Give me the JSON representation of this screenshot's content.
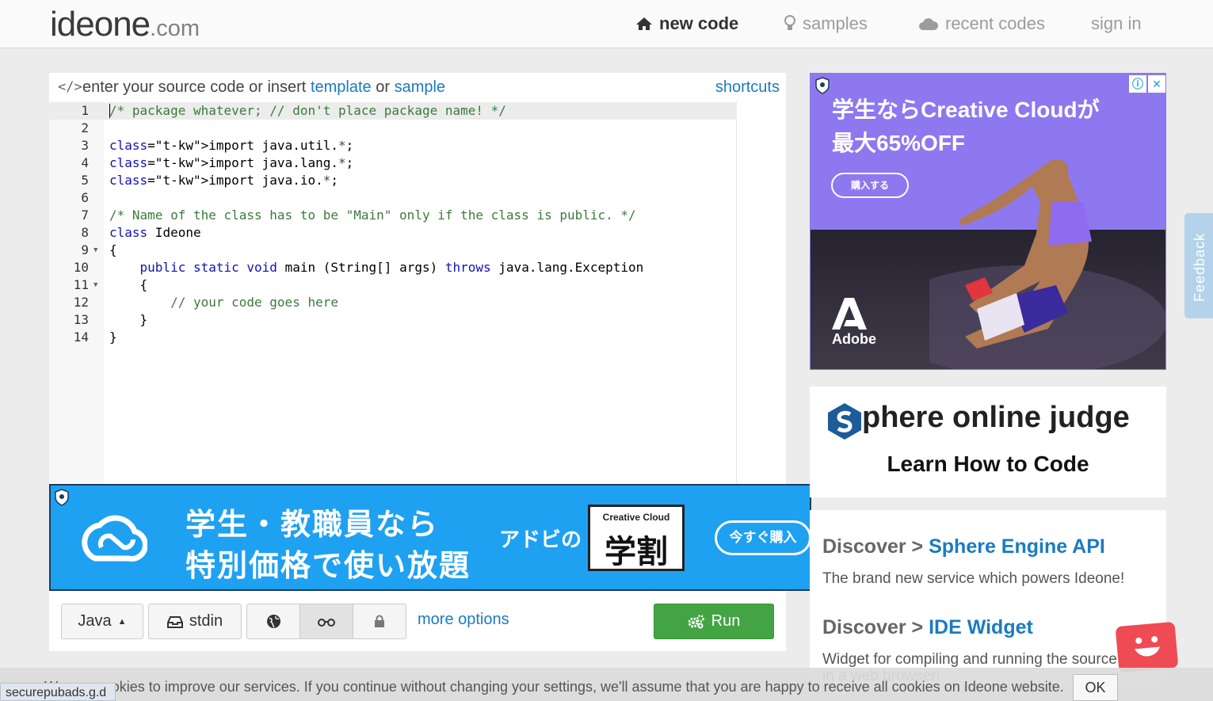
{
  "header": {
    "logo_main": "ideone",
    "logo_domain": ".com",
    "nav": [
      {
        "label": "new code",
        "icon": "home-icon",
        "active": true
      },
      {
        "label": "samples",
        "icon": "lightbulb-icon",
        "active": false
      },
      {
        "label": "recent codes",
        "icon": "cloud-icon",
        "active": false
      },
      {
        "label": "sign in",
        "icon": "",
        "active": false
      }
    ]
  },
  "editor": {
    "hint_prefix": "enter your source code or insert",
    "template_link": "template",
    "or_text": "or",
    "sample_link": "sample",
    "shortcuts_link": "shortcuts",
    "line_numbers": [
      "1",
      "2",
      "3",
      "4",
      "5",
      "6",
      "7",
      "8",
      "9",
      "10",
      "11",
      "12",
      "13",
      "14"
    ],
    "code_lines": [
      "/* package whatever; // don't place package name! */",
      "",
      "import java.util.*;",
      "import java.lang.*;",
      "import java.io.*;",
      "",
      "/* Name of the class has to be \"Main\" only if the class is public. */",
      "class Ideone",
      "{",
      "    public static void main (String[] args) throws java.lang.Exception",
      "    {",
      "        // your code goes here",
      "    }",
      "}"
    ]
  },
  "ad_banner": {
    "line1": "学生・教職員なら",
    "line2": "特別価格で使い放題",
    "adobe_no": "アドビの",
    "badge_top": "Creative Cloud",
    "badge_main": "学割",
    "buy_button": "今すぐ購入"
  },
  "controls": {
    "language": "Java",
    "stdin": "stdin",
    "more_options": "more options",
    "run": "Run"
  },
  "ad_right": {
    "line1": "学生ならCreative Cloudが",
    "line2": "最大65%OFF",
    "buy_button": "購入する",
    "brand": "Adobe"
  },
  "sphere": {
    "title": "phere online judge",
    "subtitle": "Learn How to Code"
  },
  "discover": [
    {
      "prefix": "Discover > ",
      "link": "Sphere Engine API",
      "text": "The brand new service which powers Ideone!"
    },
    {
      "prefix": "Discover > ",
      "link": "IDE Widget",
      "text": "Widget for compiling and running the source code in a web browser!"
    }
  ],
  "feedback": "Feedback",
  "cookie": {
    "message": "We use cookies to improve our services. If you continue without changing your settings, we'll assume that you are happy to receive all cookies on Ideone website.",
    "ok": "OK"
  },
  "statusbar": "securepubads.g.d"
}
